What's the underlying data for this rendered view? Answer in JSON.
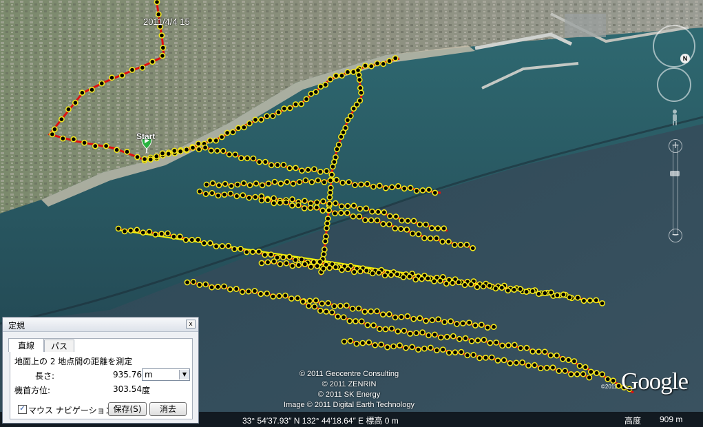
{
  "map": {
    "timestamp": "2011/4/4 15",
    "start_label": "Start",
    "credits": [
      "© 2011 Geocentre Consulting",
      "© 2011 ZENRIN",
      "© 2011 SK Energy",
      "Image © 2011 Digital Earth Technology"
    ],
    "logo_text": "Google",
    "small_copyright": "©2011"
  },
  "status_bar": {
    "coords": "33° 54′37.93″ N 132° 44′18.64″ E 標高    0 m",
    "altitude_label": "高度",
    "altitude_value": "909 m"
  },
  "nav": {
    "north_label": "N",
    "zoom_in": "+",
    "zoom_out": "−"
  },
  "ruler_dialog": {
    "title": "定規",
    "close": "x",
    "tabs": [
      "直線",
      "パス"
    ],
    "description": "地面上の 2 地点間の距離を測定",
    "length_label": "長さ:",
    "length_value": "935.76",
    "unit": "m",
    "heading_label": "機首方位:",
    "heading_value": "303.54",
    "heading_unit": "度",
    "mouse_nav_label": "マウス ナビゲーション",
    "mouse_nav_checked": "✓",
    "save_label": "保存(S)",
    "clear_label": "消去"
  },
  "colors": {
    "track_red": "#e01010",
    "marker_yellow": "#f3e81c",
    "measure_line": "#f4f400",
    "deep_sea": "#223a4a"
  }
}
